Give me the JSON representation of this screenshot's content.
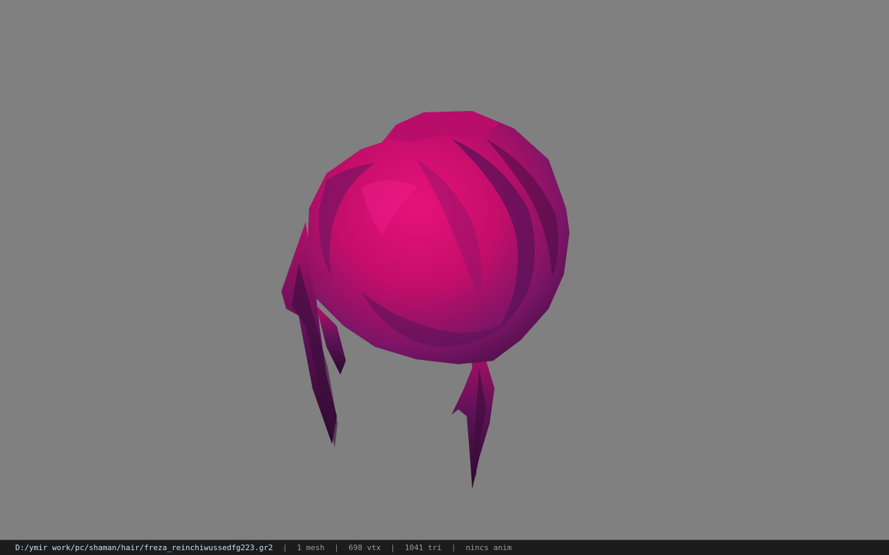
{
  "status_bar": {
    "file_path": "D:/ymir work/pc/shaman/hair/freza_reinchiwussedfg223.gr2",
    "separator": "|",
    "mesh_count": "1 mesh",
    "vertex_count": "698 vtx",
    "triangle_count": "1041 tri",
    "anim_status": "nincs anim"
  },
  "viewport": {
    "background_color": "#808080",
    "model": "hair-mesh",
    "model_colors": {
      "primary": "#d4106e",
      "dark": "#5a1258",
      "shadow": "#2e0a2e"
    }
  }
}
